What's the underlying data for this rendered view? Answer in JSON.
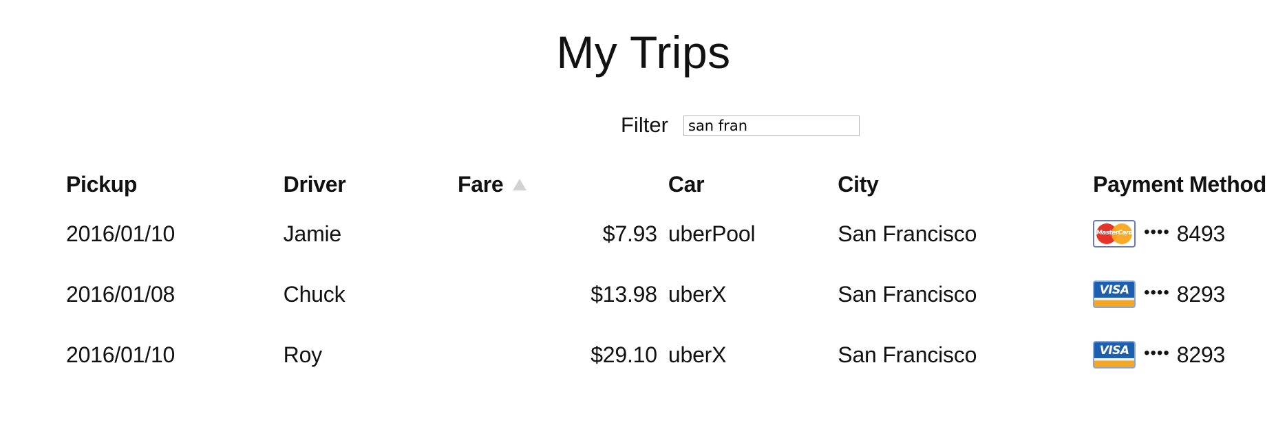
{
  "page": {
    "title": "My Trips"
  },
  "filter": {
    "label": "Filter",
    "value": "san fran"
  },
  "table": {
    "columns": [
      "Pickup",
      "Driver",
      "Fare",
      "Car",
      "City",
      "Payment Method"
    ],
    "sort": {
      "column": "Fare",
      "direction": "ascending",
      "icon": "sort-ascending-icon"
    },
    "rows": [
      {
        "pickup": "2016/01/10",
        "driver": "Jamie",
        "fare": "$7.93",
        "car": "uberPool",
        "city": "San Francisco",
        "payment": {
          "card": "mastercard-icon",
          "card_text": "MasterCard",
          "dots": "••••",
          "last4": "8493"
        }
      },
      {
        "pickup": "2016/01/08",
        "driver": "Chuck",
        "fare": "$13.98",
        "car": "uberX",
        "city": "San Francisco",
        "payment": {
          "card": "visa-icon",
          "card_text": "VISA",
          "dots": "••••",
          "last4": "8293"
        }
      },
      {
        "pickup": "2016/01/10",
        "driver": "Roy",
        "fare": "$29.10",
        "car": "uberX",
        "city": "San Francisco",
        "payment": {
          "card": "visa-icon",
          "card_text": "VISA",
          "dots": "••••",
          "last4": "8293"
        }
      }
    ]
  },
  "colors": {
    "text": "#111111",
    "sort_icon": "#d2d2d2",
    "input_border": "#b5b5b5",
    "mastercard_red": "#e6332a",
    "mastercard_yellow": "#f9a51a",
    "visa_blue": "#1b5fae",
    "visa_gold": "#f5a623"
  }
}
